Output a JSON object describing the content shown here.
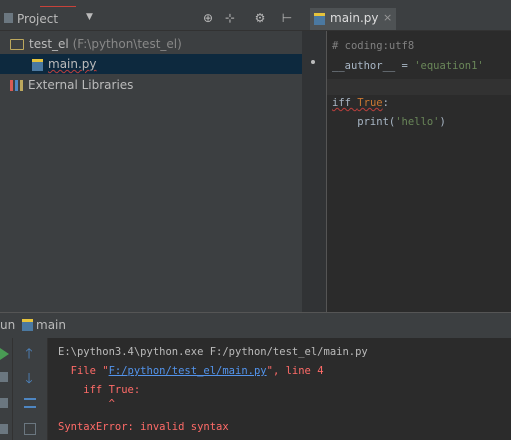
{
  "project_panel": {
    "title": "Project",
    "caret": "▼",
    "toolbar_icons": [
      "⊕",
      "⊹",
      "⚙",
      "⊢"
    ],
    "tree": [
      {
        "label": "test_el",
        "path": "(F:\\python\\test_el)",
        "icon": "folder-icon"
      },
      {
        "label": "main.py",
        "icon": "python-file-icon",
        "selected": true
      },
      {
        "label": "External Libraries",
        "icon": "library-icon"
      }
    ]
  },
  "editor": {
    "tab_label": "main.py",
    "tab_close": "×",
    "lines": {
      "l1": "# coding:utf8",
      "l2a": "__author__ = ",
      "l2b": "'equation1'",
      "l4a": "iff ",
      "l4b": "True",
      "l4c": ":",
      "l5a": "    print(",
      "l5b": "'hello'",
      "l5c": ")"
    }
  },
  "run_panel": {
    "label_prefix": "un",
    "label": "main",
    "console": {
      "cmd": "E:\\python3.4\\python.exe F:/python/test_el/main.py",
      "file_pre": "  File \"",
      "file_link": "F:/python/test_el/main.py",
      "file_post": "\", line 4",
      "code": "    iff True:",
      "caret": "        ^",
      "error": "SyntaxError: invalid syntax"
    }
  }
}
